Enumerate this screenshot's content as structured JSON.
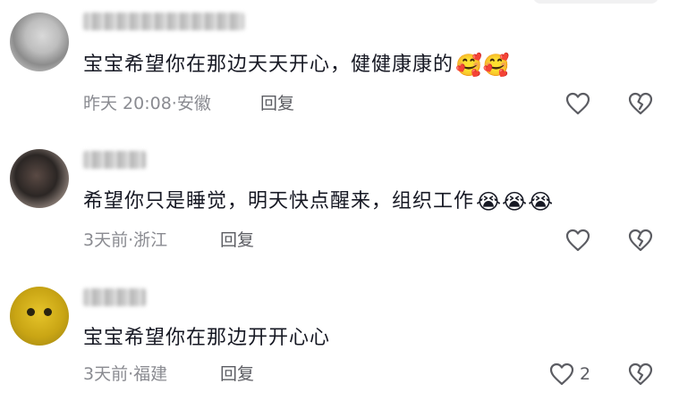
{
  "comments": [
    {
      "text": "宝宝希望你在那边天天开心，健健康康的",
      "emoji": "🥰🥰",
      "time": "昨天 20:08",
      "location": "安徽",
      "reply_label": "回复",
      "like_count": ""
    },
    {
      "text": "希望你只是睡觉，明天快点醒来，组织工作",
      "emoji": "😭😭😭",
      "time": "3天前",
      "location": "浙江",
      "reply_label": "回复",
      "like_count": ""
    },
    {
      "text": "宝宝希望你在那边开开心心",
      "emoji": "",
      "time": "3天前",
      "location": "福建",
      "reply_label": "回复",
      "like_count": "2"
    }
  ],
  "separator": "·",
  "icons": {
    "like": "heart-outline-icon",
    "dislike": "broken-heart-icon"
  },
  "colors": {
    "text": "#161823",
    "meta": "#8a8b91",
    "icon": "#5b5c62"
  }
}
